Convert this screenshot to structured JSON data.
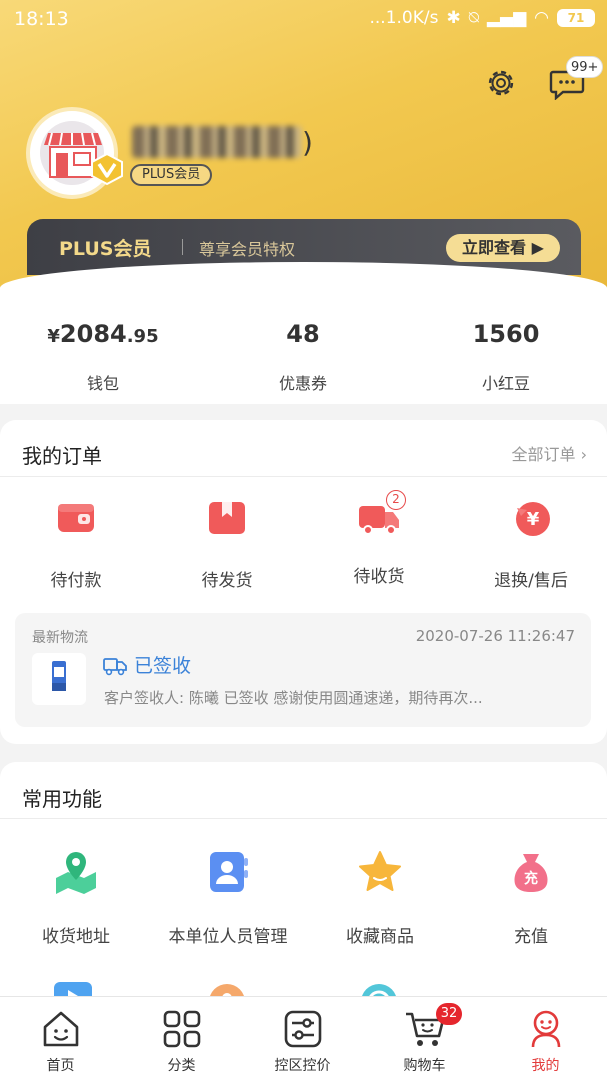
{
  "status_bar": {
    "time": "18:13",
    "network_speed": "...1.0K/s",
    "battery": "71"
  },
  "header": {
    "message_badge": "99+",
    "user_suffix": ")",
    "member_tag": "PLUS会员"
  },
  "plus_banner": {
    "title": "PLUS会员",
    "subtitle": "尊享会员特权",
    "cta": "立即查看"
  },
  "stats": [
    {
      "value_main": "2084",
      "value_decimal": ".95",
      "currency": "¥",
      "label": "钱包"
    },
    {
      "value": "48",
      "label": "优惠券"
    },
    {
      "value": "1560",
      "label": "小红豆"
    }
  ],
  "orders": {
    "title": "我的订单",
    "all_link": "全部订单",
    "items": [
      {
        "label": "待付款",
        "icon": "wallet-icon"
      },
      {
        "label": "待发货",
        "icon": "package-icon"
      },
      {
        "label": "待收货",
        "icon": "truck-icon",
        "badge": "2"
      },
      {
        "label": "退换/售后",
        "icon": "refund-icon"
      }
    ]
  },
  "logistics": {
    "heading": "最新物流",
    "time": "2020-07-26 11:26:47",
    "status": "已签收",
    "detail": "客户签收人: 陈曦 已签收 感谢使用圆通速递，期待再次..."
  },
  "functions": {
    "title": "常用功能",
    "items": [
      {
        "label": "收货地址",
        "icon": "location-map-icon"
      },
      {
        "label": "本单位人员管理",
        "icon": "contacts-icon"
      },
      {
        "label": "收藏商品",
        "icon": "star-icon"
      },
      {
        "label": "充值",
        "icon": "money-bag-icon"
      }
    ]
  },
  "tabbar": [
    {
      "label": "首页",
      "icon": "home-icon"
    },
    {
      "label": "分类",
      "icon": "category-icon"
    },
    {
      "label": "控区控价",
      "icon": "price-control-icon"
    },
    {
      "label": "购物车",
      "icon": "cart-icon",
      "badge": "32"
    },
    {
      "label": "我的",
      "icon": "profile-icon",
      "active": true
    }
  ],
  "colors": {
    "accent_red": "#e23a3a",
    "gold": "#f2c84f",
    "link_blue": "#3b82d8"
  }
}
